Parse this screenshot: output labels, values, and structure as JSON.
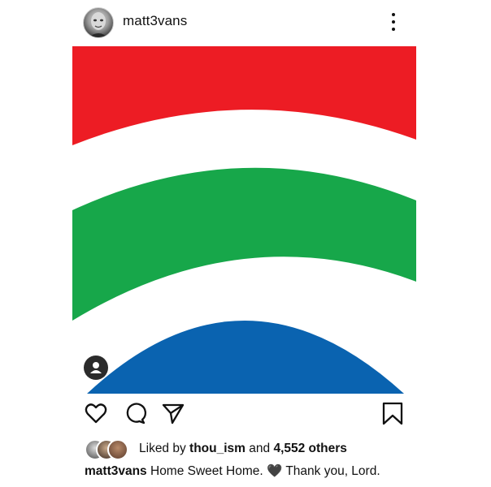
{
  "post": {
    "username": "matt3vans",
    "likes": {
      "prefix": "Liked by",
      "user": "thou_ism",
      "conjunction": "and",
      "others": "4,552 others"
    },
    "caption": {
      "username": "matt3vans",
      "text": " Home Sweet Home. 🖤 Thank you, Lord."
    }
  },
  "icons": {
    "more": "more-vertical-icon",
    "like": "heart-icon",
    "comment": "comment-icon",
    "share": "send-icon",
    "save": "bookmark-icon",
    "tag": "user-tag-icon"
  },
  "colors": {
    "red": "#ED1C24",
    "green": "#17A74A",
    "blue": "#0A63B0",
    "white": "#FFFFFF"
  }
}
